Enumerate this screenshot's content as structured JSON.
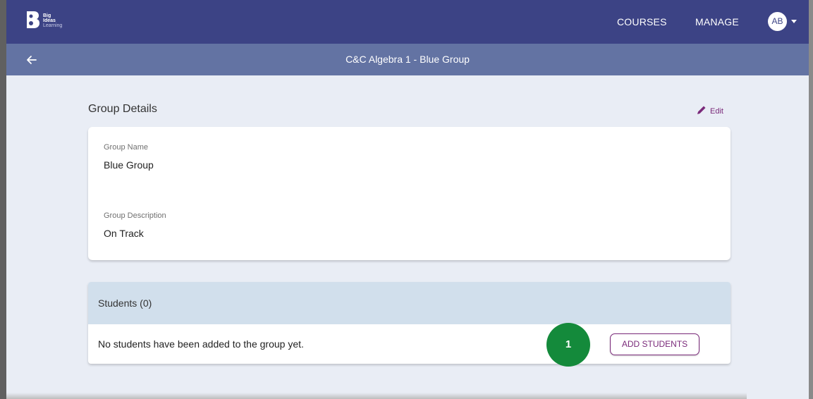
{
  "header": {
    "logo": {
      "line1": "Big",
      "line2": "Ideas",
      "line3": "Learning"
    },
    "nav": [
      {
        "label": "COURSES"
      },
      {
        "label": "MANAGE"
      }
    ],
    "avatar_initials": "AB",
    "brand_color": "#3c4385"
  },
  "subheader": {
    "title": "C&C Algebra 1 - Blue Group",
    "back_icon": "arrow-left-icon"
  },
  "group_details": {
    "title": "Group Details",
    "edit_label": "Edit",
    "fields": [
      {
        "label": "Group Name",
        "value": "Blue Group"
      },
      {
        "label": "Group Description",
        "value": "On Track"
      }
    ]
  },
  "students": {
    "title": "Students (0)",
    "empty_message": "No students have been added to the group yet.",
    "add_label": "ADD STUDENTS",
    "accent_color": "#7a2a7a"
  },
  "callout": {
    "number": "1",
    "color": "#148a3b"
  }
}
